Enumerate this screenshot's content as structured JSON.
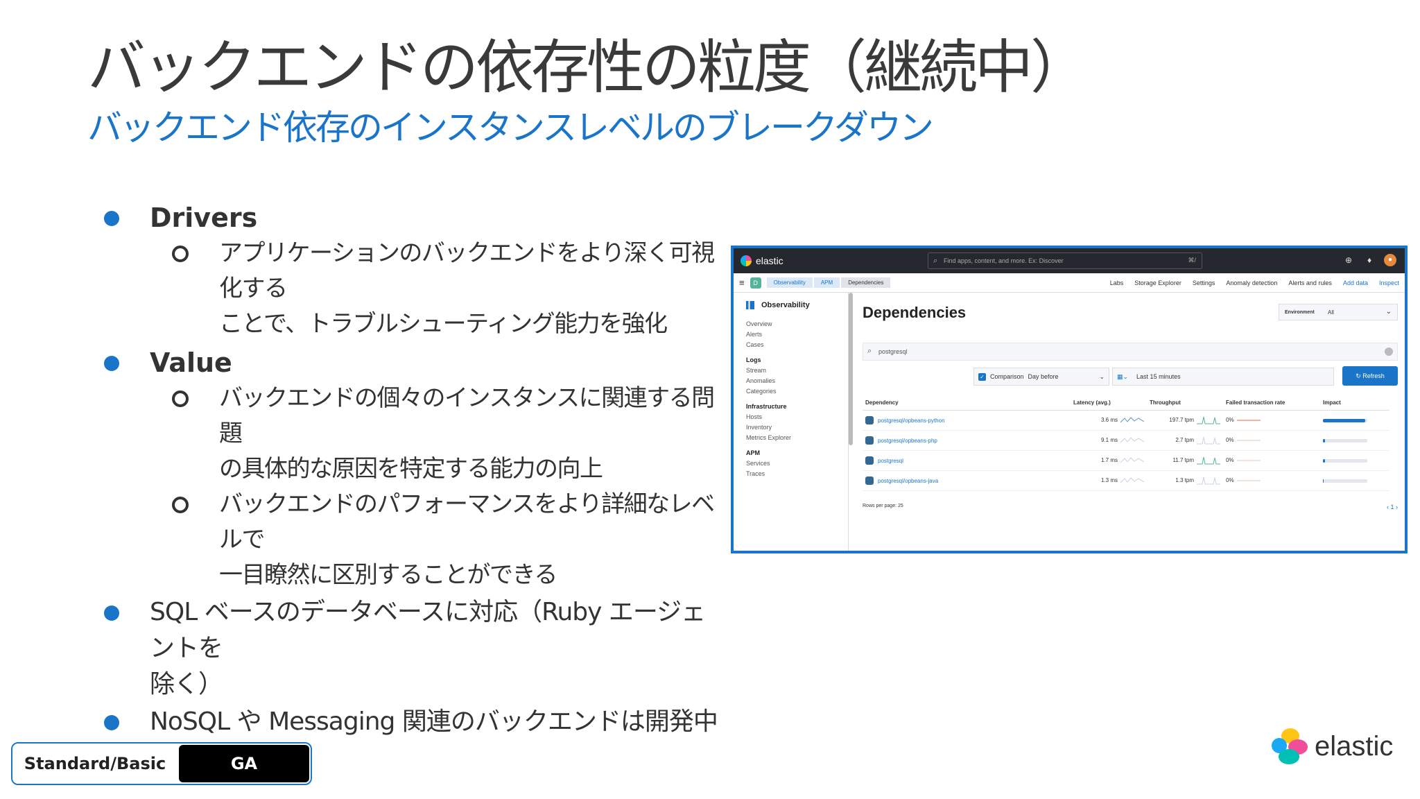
{
  "slide": {
    "title": "バックエンドの依存性の粒度（継続中）",
    "subtitle": "バックエンド依存のインスタンスレベルのブレークダウン",
    "bullets": [
      {
        "label": "Drivers",
        "subs": [
          "アプリケーションのバックエンドをより深く可視化する",
          "ことで、トラブルシューティング能力を強化"
        ]
      },
      {
        "label": "Value",
        "subs": [
          "バックエンドの個々のインスタンスに関連する問題",
          "の具体的な原因を特定する能力の向上",
          "バックエンドのパフォーマンスをより詳細なレベルで",
          "一目瞭然に区別することができる"
        ]
      },
      {
        "label": "SQL ベースのデータベースに対応（Ruby エージェントを",
        "cont": "除く）"
      },
      {
        "label": "NoSQL や Messaging 関連のバックエンドは開発中"
      }
    ],
    "badge": {
      "tier": "Standard/Basic",
      "status": "GA"
    },
    "brand": "elastic"
  },
  "screenshot": {
    "logo": "elastic",
    "search_placeholder": "Find apps, content, and more. Ex: Discover",
    "search_kbd": "⌘/",
    "space": "D",
    "breadcrumbs": [
      "Observability",
      "APM",
      "Dependencies"
    ],
    "nav": [
      "Labs",
      "Storage Explorer",
      "Settings",
      "Anomaly detection",
      "Alerts and rules",
      "Add data",
      "Inspect"
    ],
    "sidebar": {
      "title": "Observability",
      "top": [
        "Overview",
        "Alerts",
        "Cases"
      ],
      "logs_label": "Logs",
      "logs": [
        "Stream",
        "Anomalies",
        "Categories"
      ],
      "infra_label": "Infrastructure",
      "infra": [
        "Hosts",
        "Inventory",
        "Metrics Explorer"
      ],
      "apm_label": "APM",
      "apm": [
        "Services",
        "Traces"
      ]
    },
    "page_title": "Dependencies",
    "environment_label": "Environment",
    "environment_value": "All",
    "search_value": "postgresql",
    "comparison_label": "Comparison",
    "comparison_value": "Day before",
    "time_value": "Last 15 minutes",
    "refresh_label": "Refresh",
    "columns": [
      "Dependency",
      "Latency (avg.)",
      "Throughput",
      "Failed transaction rate",
      "Impact"
    ],
    "rows": [
      {
        "name": "postgresql/opbeans-python",
        "latency": "3.6 ms",
        "throughput": "197.7 tpm",
        "failed": "0%",
        "impact": 0.95
      },
      {
        "name": "postgresql/opbeans-php",
        "latency": "9.1 ms",
        "throughput": "2.7 tpm",
        "failed": "0%",
        "impact": 0.05
      },
      {
        "name": "postgresql",
        "latency": "1.7 ms",
        "throughput": "11.7 tpm",
        "failed": "0%",
        "impact": 0.05
      },
      {
        "name": "postgresql/opbeans-java",
        "latency": "1.3 ms",
        "throughput": "1.3 tpm",
        "failed": "0%",
        "impact": 0.02
      }
    ],
    "rows_per_page": "Rows per page: 25",
    "page_number": "1"
  },
  "colors": {
    "accent": "#1a75c9",
    "dark": "#25282f"
  }
}
